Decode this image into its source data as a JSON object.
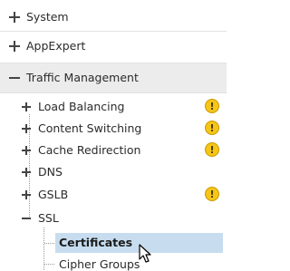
{
  "nav": {
    "system": {
      "label": "System"
    },
    "appexpert": {
      "label": "AppExpert"
    },
    "traffic_management": {
      "label": "Traffic Management",
      "items": {
        "load_balancing": {
          "label": "Load Balancing",
          "warning": true
        },
        "content_switching": {
          "label": "Content Switching",
          "warning": true
        },
        "cache_redirection": {
          "label": "Cache Redirection",
          "warning": true
        },
        "dns": {
          "label": "DNS",
          "warning": false
        },
        "gslb": {
          "label": "GSLB",
          "warning": true
        },
        "ssl": {
          "label": "SSL",
          "children": {
            "certificates": {
              "label": "Certificates",
              "selected": true
            },
            "cipher_groups": {
              "label": "Cipher Groups"
            }
          }
        }
      }
    }
  },
  "icons": {
    "warning_glyph": "!",
    "warning_color": "#f5c518",
    "selected_color": "#c7ddef"
  }
}
